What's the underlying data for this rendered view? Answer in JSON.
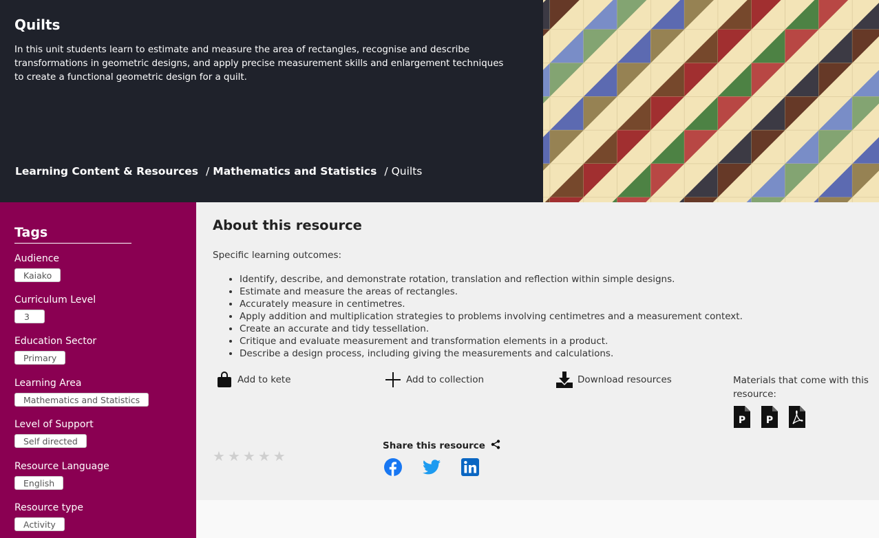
{
  "hero": {
    "title": "Quilts",
    "description": "In this unit students learn to estimate and measure the area of rectangles, recognise and describe transformations in geometric designs, and apply precise measurement skills and enlargement techniques to create a functional geometric design for a quilt.",
    "breadcrumb": [
      "Learning Content & Resources",
      "Mathematics and Statistics",
      "Quilts"
    ],
    "separator": "/"
  },
  "sidebar": {
    "title": "Tags",
    "groups": [
      {
        "label": "Audience",
        "value": "Kaiako"
      },
      {
        "label": "Curriculum Level",
        "value": "3"
      },
      {
        "label": "Education Sector",
        "value": "Primary"
      },
      {
        "label": "Learning Area",
        "value": "Mathematics and Statistics"
      },
      {
        "label": "Level of Support",
        "value": "Self directed"
      },
      {
        "label": "Resource Language",
        "value": "English"
      },
      {
        "label": "Resource type",
        "value": "Activity"
      }
    ]
  },
  "about": {
    "title": "About this resource",
    "outcomes_label": "Specific learning outcomes:",
    "outcomes": [
      "Identify, describe, and demonstrate rotation, translation and reflection within simple designs.",
      "Estimate and measure the areas of rectangles.",
      "Accurately measure in centimetres.",
      "Apply addition and multiplication strategies to problems involving centimetres and a measurement context.",
      "Create an accurate and tidy tessellation.",
      "Critique and evaluate measurement and transformation elements in a product.",
      "Describe a design process, including giving the measurements and calculations."
    ]
  },
  "actions": {
    "kete": "Add to kete",
    "collection": "Add to collection",
    "download": "Download resources",
    "materials_label": "Materials that come with this resource:",
    "material_icons": [
      "pptx-file-icon",
      "pptx-file-icon",
      "pdf-file-icon"
    ]
  },
  "rating": {
    "stars": 5,
    "value": 0
  },
  "share": {
    "label": "Share this resource",
    "networks": [
      "facebook-icon",
      "twitter-icon",
      "linkedin-icon"
    ]
  },
  "colors": {
    "hero_bg": "#1f222b",
    "sidebar_bg": "#8a0052",
    "main_bg": "#f0f0f0",
    "facebook": "#1877f2",
    "twitter": "#1d9bf0",
    "linkedin": "#0a66c2"
  }
}
